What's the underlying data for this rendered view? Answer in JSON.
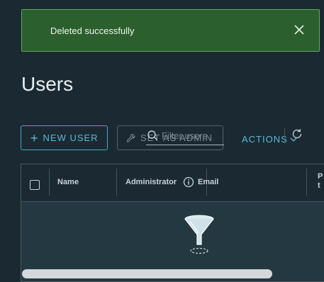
{
  "toast": {
    "message": "Deleted successfully",
    "close_icon": "close-icon",
    "bg_color": "#2b5f2d"
  },
  "page": {
    "title": "Users"
  },
  "toolbar": {
    "new_user_label": "NEW USER",
    "new_user_icon": "plus-icon",
    "set_admin_label": "SET AS ADMIN",
    "set_admin_icon": "wrench-icon",
    "filter_placeholder": "Filter users",
    "filter_icon": "search-icon",
    "actions_label": "ACTIONS",
    "actions_icon": "chevron-down-icon",
    "refresh_icon": "refresh-icon"
  },
  "grid": {
    "columns": [
      {
        "label": "Name"
      },
      {
        "label": "Administrator"
      },
      {
        "label": "Email"
      },
      {
        "label": "P\nt"
      }
    ],
    "empty_icon": "funnel-icon",
    "accent_color": "#49a6c9"
  }
}
